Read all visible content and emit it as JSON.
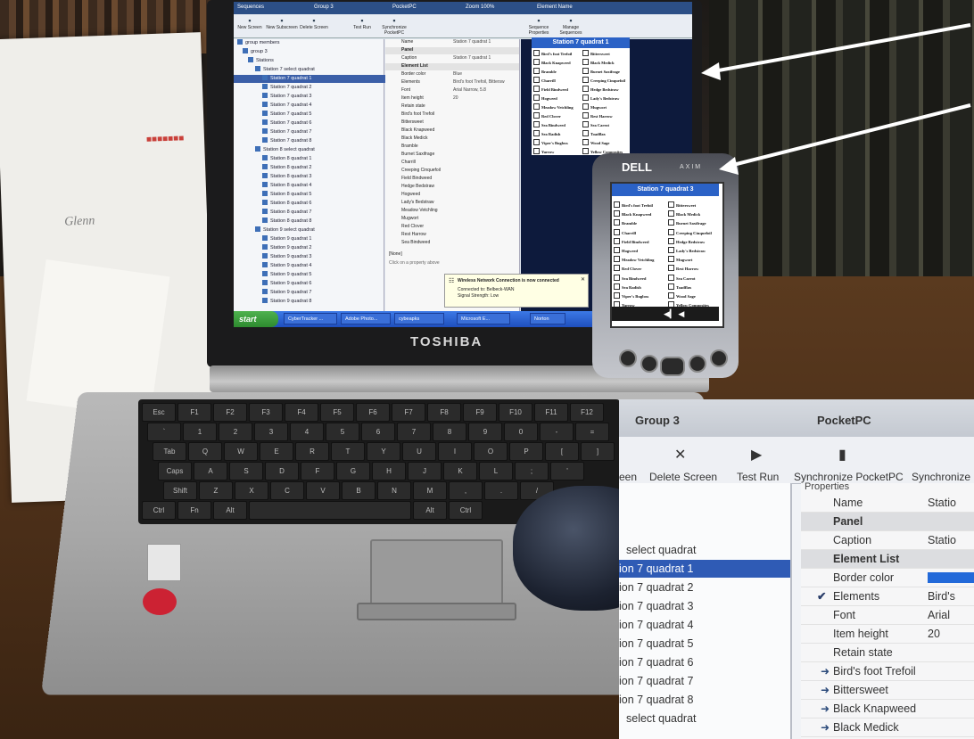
{
  "scene": {
    "laptop_brand": "TOSHIBA",
    "pda_brand": "DELL",
    "pda_model": "AXIM",
    "paper_handwriting": "Glenn"
  },
  "laptop_app": {
    "menu": [
      "Sequences",
      "Group 3",
      "PocketPC",
      "Zoom 100%",
      "Element Name"
    ],
    "toolbar": [
      "New Screen",
      "New Subscreen",
      "Delete Screen",
      "Test Run",
      "Synchronize PocketPC",
      "Sequence Properties",
      "Manage Sequences"
    ],
    "tree": [
      "group members",
      "group 3",
      "Stations",
      "Station 7 select quadrat",
      "Station 7 quadrat 1",
      "Station 7 quadrat 2",
      "Station 7 quadrat 3",
      "Station 7 quadrat 4",
      "Station 7 quadrat 5",
      "Station 7 quadrat 6",
      "Station 7 quadrat 7",
      "Station 7 quadrat 8",
      "Station 8 select quadrat",
      "Station 8 quadrat 1",
      "Station 8 quadrat 2",
      "Station 8 quadrat 3",
      "Station 8 quadrat 4",
      "Station 8 quadrat 5",
      "Station 8 quadrat 6",
      "Station 8 quadrat 7",
      "Station 8 quadrat 8",
      "Station 9 select quadrat",
      "Station 9 quadrat 1",
      "Station 9 quadrat 2",
      "Station 9 quadrat 3",
      "Station 9 quadrat 4",
      "Station 9 quadrat 5",
      "Station 9 quadrat 6",
      "Station 9 quadrat 7",
      "Station 9 quadrat 8"
    ],
    "properties": [
      {
        "k": "Name",
        "v": "Station 7 quadrat 1"
      },
      {
        "k": "Panel",
        "v": "",
        "hdr": true
      },
      {
        "k": "Caption",
        "v": "Station 7 quadrat 1"
      },
      {
        "k": "Element List",
        "v": "",
        "hdr": true
      },
      {
        "k": "Border color",
        "v": "Blue"
      },
      {
        "k": "Elements",
        "v": "Bird's foot Trefoil, Bittersw"
      },
      {
        "k": "Font",
        "v": "Arial Narrow, 5.8"
      },
      {
        "k": "Item height",
        "v": "20"
      },
      {
        "k": "Retain state",
        "v": ""
      },
      {
        "k": "Bird's foot Trefoil",
        "v": ""
      },
      {
        "k": "Bittersweet",
        "v": ""
      },
      {
        "k": "Black Knapweed",
        "v": ""
      },
      {
        "k": "Black Medick",
        "v": ""
      },
      {
        "k": "Bramble",
        "v": ""
      },
      {
        "k": "Burnet Saxifrage",
        "v": ""
      },
      {
        "k": "Charrill",
        "v": ""
      },
      {
        "k": "Creeping Cinquefoil",
        "v": ""
      },
      {
        "k": "Field Bindweed",
        "v": ""
      },
      {
        "k": "Hedge Bedstraw",
        "v": ""
      },
      {
        "k": "Hogweed",
        "v": ""
      },
      {
        "k": "Lady's Bedstraw",
        "v": ""
      },
      {
        "k": "Meadow Vetchling",
        "v": ""
      },
      {
        "k": "Mugwort",
        "v": ""
      },
      {
        "k": "Red Clover",
        "v": ""
      },
      {
        "k": "Rest Harrow",
        "v": ""
      },
      {
        "k": "Sea Bindweed",
        "v": ""
      }
    ],
    "props_footer": "[None]",
    "props_hint": "Click on a property above",
    "preview_title": "Station 7 quadrat 1",
    "preview_items": [
      "Bird's foot Trefoil",
      "Bittersweet",
      "Black Knapweed",
      "Black Medick",
      "Bramble",
      "Burnet Saxifrage",
      "Charrill",
      "Creeping Cinquefoil",
      "Field Bindweed",
      "Hedge Bedstraw",
      "Hogweed",
      "Lady's Bedstraw",
      "Meadow Vetchling",
      "Mugwort",
      "Red Clover",
      "Rest Harrow",
      "Sea Bindweed",
      "Sea Carrot",
      "Sea Radish",
      "Toadflax",
      "Viper's Bugloss",
      "Wood Sage",
      "Yarrow",
      "Yellow Composites"
    ],
    "notification": {
      "title": "Wireless Network Connection is now connected",
      "line1": "Connected to: Belbeck-WAN",
      "line2": "Signal Strength: Low"
    },
    "taskbar": {
      "start": "start",
      "tasks": [
        "CyberTracker ...",
        "Adobe Photo...",
        "cybeapks",
        "Microsoft E...",
        "Norton"
      ]
    }
  },
  "pda": {
    "title": "Station 7 quadrat 3",
    "items": [
      "Bird's foot Trefoil",
      "Bittersweet",
      "Black Knapweed",
      "Black Medick",
      "Bramble",
      "Burnet Saxifrage",
      "Charrill",
      "Creeping Cinquefoil",
      "Field Bindweed",
      "Hedge Bedstraw",
      "Hogweed",
      "Lady's Bedstraw",
      "Meadow Vetchling",
      "Mugwort",
      "Red Clover",
      "Rest Harrow",
      "Sea Bindweed",
      "Sea Carrot",
      "Sea Radish",
      "Toadflax",
      "Viper's Bugloss",
      "Wood Sage",
      "Yarrow",
      "Yellow Composites"
    ]
  },
  "zoom_inset": {
    "menu": [
      "Group 3",
      "PocketPC"
    ],
    "toolbar": [
      "een",
      "Delete Screen",
      "Test Run",
      "Synchronize PocketPC",
      "Synchronize"
    ],
    "tree": [
      "",
      "",
      "",
      "select quadrat",
      "ion 7 quadrat 1",
      "ion 7 quadrat 2",
      "ion 7 quadrat 3",
      "ion 7 quadrat 4",
      "ion 7 quadrat 5",
      "ion 7 quadrat 6",
      "ion 7 quadrat 7",
      "ion 7 quadrat 8",
      "select quadrat"
    ],
    "properties_header": "Properties",
    "properties": [
      {
        "k": "Name",
        "v": "Statio"
      },
      {
        "k": "Panel",
        "v": "",
        "hdr": true
      },
      {
        "k": "Caption",
        "v": "Statio"
      },
      {
        "k": "Element List",
        "v": "",
        "hdr": true
      },
      {
        "k": "Border color",
        "v": ""
      },
      {
        "k": "Elements",
        "v": "Bird's"
      },
      {
        "k": "Font",
        "v": "Arial"
      },
      {
        "k": "Item height",
        "v": "20"
      },
      {
        "k": "Retain state",
        "v": ""
      },
      {
        "k": "Bird's foot Trefoil",
        "v": ""
      },
      {
        "k": "Bittersweet",
        "v": ""
      },
      {
        "k": "Black Knapweed",
        "v": ""
      },
      {
        "k": "Black Medick",
        "v": ""
      }
    ]
  },
  "colors": {
    "selection_blue": "#2f5bb5",
    "title_blue": "#2b62c6",
    "swatch_blue": "#2269d9"
  }
}
